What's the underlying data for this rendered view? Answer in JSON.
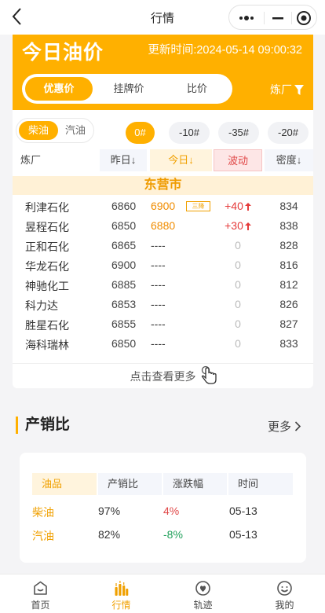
{
  "navbar": {
    "title": "行情"
  },
  "hero": {
    "title": "今日油价",
    "update_time": "更新时间:2024-05-14 09:00:32",
    "segments": [
      {
        "label": "优惠价",
        "active": true
      },
      {
        "label": "挂牌价",
        "active": false
      },
      {
        "label": "比价",
        "active": false
      }
    ],
    "refinery_filter": "炼厂"
  },
  "filters": {
    "fuel_types": [
      {
        "label": "柴油",
        "active": true
      },
      {
        "label": "汽油",
        "active": false
      }
    ],
    "grades": [
      {
        "label": "0#",
        "active": true
      },
      {
        "label": "-10#",
        "active": false
      },
      {
        "label": "-35#",
        "active": false
      },
      {
        "label": "-20#",
        "active": false
      }
    ]
  },
  "table": {
    "headers": {
      "refinery": "炼厂",
      "yesterday": "昨日↓",
      "today": "今日↓",
      "change": "波动",
      "density": "密度↓"
    },
    "city": "东营市",
    "rows": [
      {
        "name": "利津石化",
        "yesterday": "6860",
        "today": "6900",
        "tag": "三降",
        "change": "+40",
        "density": "834",
        "up": true
      },
      {
        "name": "昱程石化",
        "yesterday": "6850",
        "today": "6880",
        "tag": "",
        "change": "+30",
        "density": "838",
        "up": true
      },
      {
        "name": "正和石化",
        "yesterday": "6865",
        "today": "----",
        "tag": "",
        "change": "0",
        "density": "828",
        "up": false
      },
      {
        "name": "华龙石化",
        "yesterday": "6900",
        "today": "----",
        "tag": "",
        "change": "0",
        "density": "816",
        "up": false
      },
      {
        "name": "神驰化工",
        "yesterday": "6885",
        "today": "----",
        "tag": "",
        "change": "0",
        "density": "812",
        "up": false
      },
      {
        "name": "科力达",
        "yesterday": "6853",
        "today": "----",
        "tag": "",
        "change": "0",
        "density": "826",
        "up": false
      },
      {
        "name": "胜星石化",
        "yesterday": "6855",
        "today": "----",
        "tag": "",
        "change": "0",
        "density": "827",
        "up": false
      },
      {
        "name": "海科瑞林",
        "yesterday": "6850",
        "today": "----",
        "tag": "",
        "change": "0",
        "density": "833",
        "up": false
      }
    ],
    "more_label": "点击查看更多"
  },
  "ratio": {
    "title": "产销比",
    "more_label": "更多",
    "headers": [
      "油品",
      "产销比",
      "涨跌幅",
      "时间"
    ],
    "rows": [
      {
        "fuel": "柴油",
        "ratio": "97%",
        "change": "4%",
        "date": "05-13",
        "trend": "pos"
      },
      {
        "fuel": "汽油",
        "ratio": "82%",
        "change": "-8%",
        "date": "05-13",
        "trend": "neg"
      }
    ]
  },
  "tabbar": {
    "items": [
      {
        "label": "首页",
        "icon": "home-icon",
        "active": false
      },
      {
        "label": "行情",
        "icon": "market-icon",
        "active": true
      },
      {
        "label": "轨迹",
        "icon": "track-icon",
        "active": false
      },
      {
        "label": "我的",
        "icon": "profile-icon",
        "active": false
      }
    ]
  },
  "colors": {
    "accent": "#ffb000",
    "up": "#e53b3b",
    "down": "#20a05a"
  }
}
